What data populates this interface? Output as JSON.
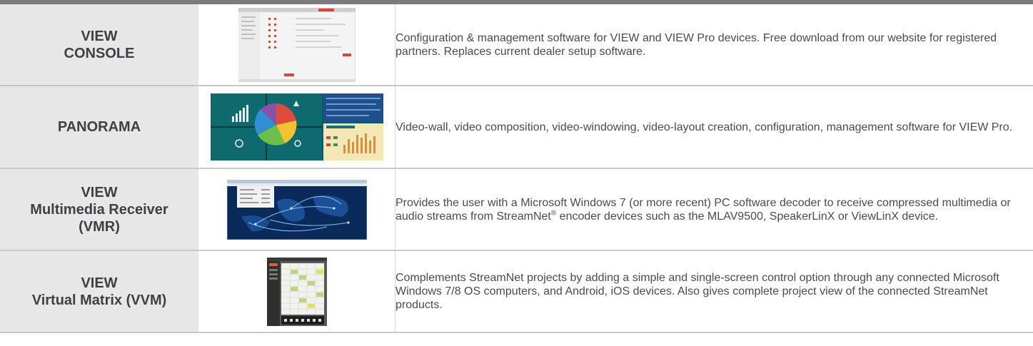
{
  "rows": [
    {
      "name_lines": [
        "VIEW",
        "CONSOLE"
      ],
      "description": "Configuration & management software for VIEW and VIEW Pro devices. Free download from our website for registered partners. Replaces current dealer setup software."
    },
    {
      "name_lines": [
        "PANORAMA"
      ],
      "description": "Video-wall, video composition, video-windowing, video-layout creation, configuration, management software for VIEW Pro."
    },
    {
      "name_lines": [
        "VIEW",
        "Multimedia Receiver",
        "(VMR)"
      ],
      "description_before": "Provides the user with a Microsoft Windows 7 (or more recent) PC software decoder to receive compressed multimedia or audio streams from StreamNet",
      "description_sup": "®",
      "description_after": " encoder devices such as the MLAV9500, SpeakerLinX or ViewLinX device."
    },
    {
      "name_lines": [
        "VIEW",
        "Virtual Matrix (VVM)"
      ],
      "description": "Complements StreamNet projects by adding a simple and single-screen control option through any connected Microsoft Windows 7/8 OS computers, and Android, iOS devices. Also gives complete project view of the connected StreamNet products."
    }
  ]
}
